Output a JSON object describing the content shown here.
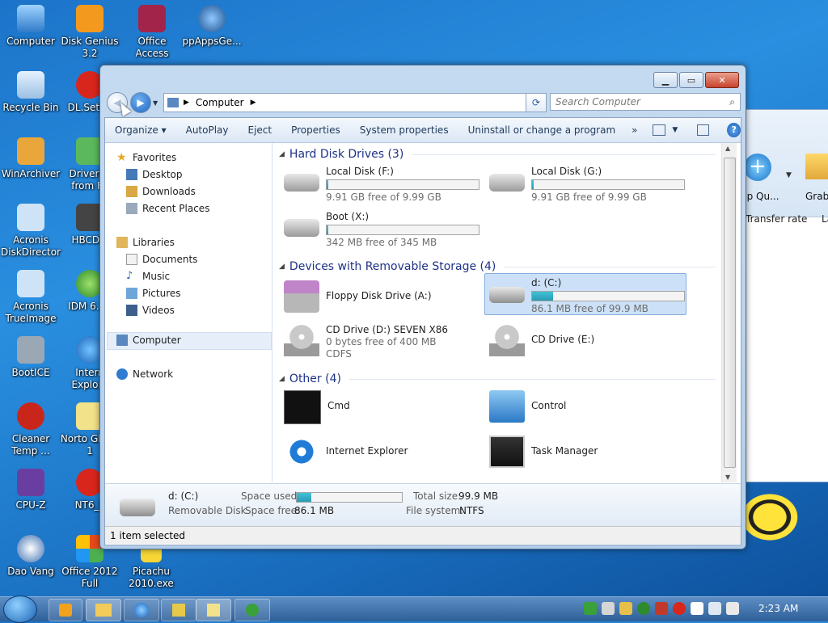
{
  "desktop_icons": [
    "Computer",
    "Disk Genius 3.2",
    "Office Access",
    "ppAppsGe...",
    "Recycle Bin",
    "DL.Setup",
    "WinArchiver",
    "DriverPa from Fo",
    "Acronis DiskDirector",
    "HBCDM",
    "Acronis TrueImage",
    "IDM 6.12",
    "BootICE",
    "Intern Explore",
    "Cleaner Temp ...",
    "Norto Ghost 1",
    "CPU-Z",
    "NT6_F",
    "Dao Vang",
    "Office 2012 Full",
    "Picachu 2010.exe"
  ],
  "background_window": {
    "toolbar_label": "pp Qu...",
    "toolbar_label2": "Grabb",
    "column1": "Transfer rate",
    "column2": "La"
  },
  "window": {
    "address_path": "Computer",
    "search_placeholder": "Search Computer",
    "toolbar": [
      "Organize",
      "AutoPlay",
      "Eject",
      "Properties",
      "System properties",
      "Uninstall or change a program"
    ],
    "toolbar_more": "»",
    "nav": {
      "favorites": "Favorites",
      "desktop": "Desktop",
      "downloads": "Downloads",
      "recent": "Recent Places",
      "libraries": "Libraries",
      "documents": "Documents",
      "music": "Music",
      "pictures": "Pictures",
      "videos": "Videos",
      "computer": "Computer",
      "network": "Network"
    },
    "groups": {
      "hdd": "Hard Disk Drives (3)",
      "removable": "Devices with Removable Storage (4)",
      "other": "Other (4)"
    },
    "drives": [
      {
        "name": "Local Disk (F:)",
        "free": "9.91 GB free of 9.99 GB",
        "used": 0.01
      },
      {
        "name": "Local Disk (G:)",
        "free": "9.91 GB free of 9.99 GB",
        "used": 0.01
      },
      {
        "name": "Boot (X:)",
        "free": "342 MB free of 345 MB",
        "used": 0.01
      }
    ],
    "removable": [
      {
        "name": "Floppy Disk Drive (A:)"
      },
      {
        "name": "d: (C:)",
        "free": "86.1 MB free of 99.9 MB",
        "used": 0.14
      },
      {
        "name": "CD Drive (D:) SEVEN X86",
        "free": "0 bytes free of 400 MB",
        "fs": "CDFS"
      },
      {
        "name": "CD Drive (E:)"
      }
    ],
    "other": [
      "Cmd",
      "Control",
      "Internet Explorer",
      "Task Manager"
    ],
    "details": {
      "name": "d: (C:)",
      "type": "Removable Disk",
      "space_used_label": "Space used:",
      "space_free_label": "Space free:",
      "space_free": "86.1 MB",
      "total_label": "Total size:",
      "total": "99.9 MB",
      "fs_label": "File system:",
      "fs": "NTFS",
      "used_fraction": 0.14
    },
    "status": "1 item selected"
  },
  "clock": "2:23 AM"
}
